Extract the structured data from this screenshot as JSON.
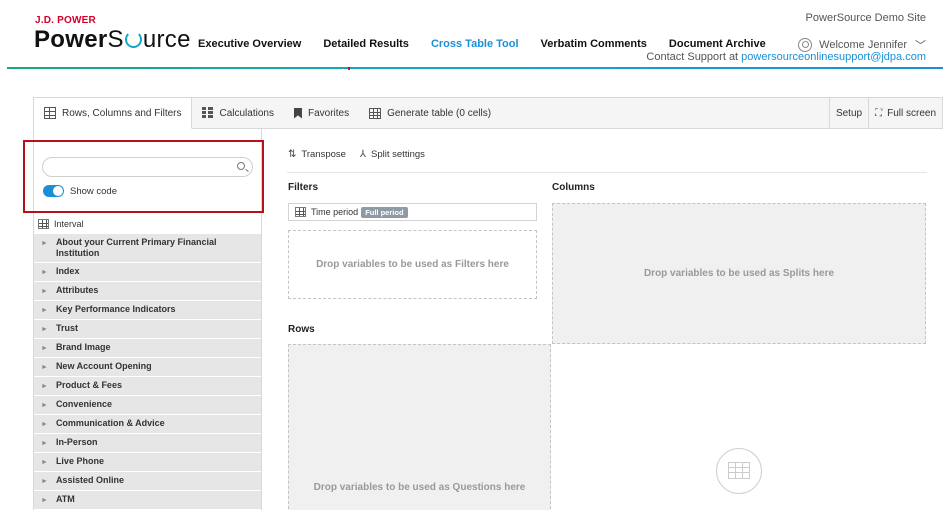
{
  "brand": {
    "company": "J.D. POWER",
    "product_bold": "Power",
    "product_rest": "urce"
  },
  "header": {
    "site_name": "PowerSource Demo Site",
    "welcome": "Welcome Jennifer",
    "support_prefix": "Contact Support at ",
    "support_email": "powersourceonlinesupport@jdpa.com",
    "nav": [
      {
        "label": "Executive Overview",
        "active": false
      },
      {
        "label": "Detailed Results",
        "active": false
      },
      {
        "label": "Cross Table Tool",
        "active": true
      },
      {
        "label": "Verbatim Comments",
        "active": false
      },
      {
        "label": "Document Archive",
        "active": false
      }
    ]
  },
  "toolbar": {
    "tabs": [
      {
        "label": "Rows, Columns and Filters",
        "icon": "grid-icon",
        "active": true
      },
      {
        "label": "Calculations",
        "icon": "calculator-icon",
        "active": false
      },
      {
        "label": "Favorites",
        "icon": "bookmark-icon",
        "active": false
      },
      {
        "label": "Generate table (0 cells)",
        "icon": "table-icon",
        "active": false
      }
    ],
    "setup": "Setup",
    "fullscreen": "Full screen"
  },
  "sidebar": {
    "search_placeholder": "",
    "show_code_label": "Show code",
    "show_code_on": true,
    "interval_label": "Interval",
    "variables": [
      "About your Current Primary Financial Institution",
      "Index",
      "Attributes",
      "Key Performance Indicators",
      "Trust",
      "Brand Image",
      "New Account Opening",
      "Product & Fees",
      "Convenience",
      "Communication & Advice",
      "In-Person",
      "Live Phone",
      "Assisted Online",
      "ATM"
    ]
  },
  "main": {
    "transpose": "Transpose",
    "split_settings": "Split settings",
    "filters_label": "Filters",
    "columns_label": "Columns",
    "rows_label": "Rows",
    "time_period": "Time period",
    "time_period_badge": "Full period",
    "drop_filters": "Drop variables to be used as Filters here",
    "drop_splits": "Drop variables to be used as Splits here",
    "drop_questions": "Drop variables to be used as Questions here"
  },
  "colors": {
    "brand_red": "#d3002b",
    "accent_blue": "#1a8fd6",
    "highlight_border": "#b8101a"
  }
}
